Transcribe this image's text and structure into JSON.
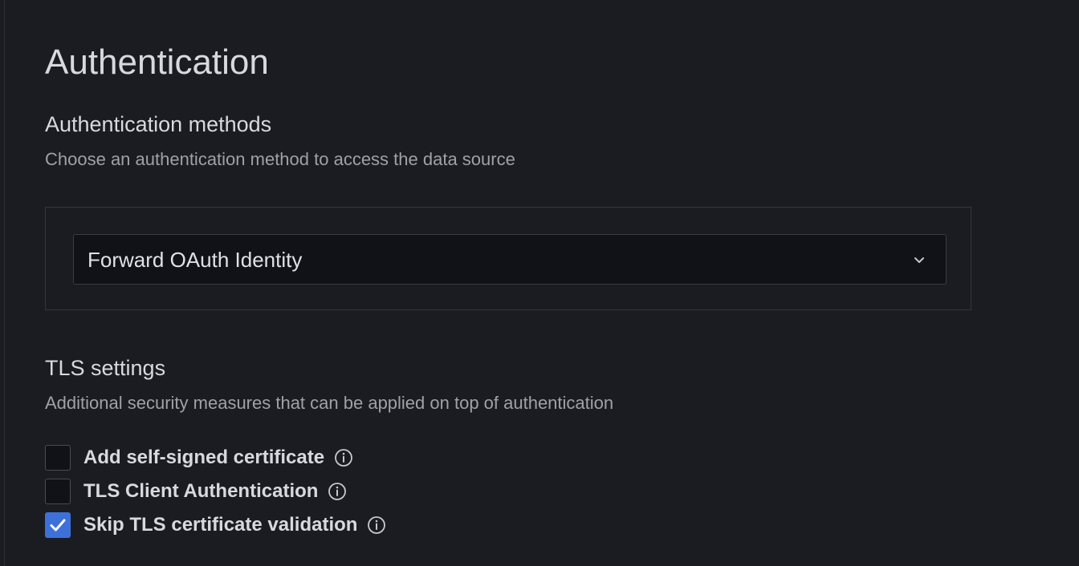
{
  "page": {
    "title": "Authentication"
  },
  "auth_methods": {
    "title": "Authentication methods",
    "description": "Choose an authentication method to access the data source",
    "select": {
      "value": "Forward OAuth Identity",
      "icon": "chevron-down-icon"
    }
  },
  "tls": {
    "title": "TLS settings",
    "description": "Additional security measures that can be applied on top of authentication",
    "options": [
      {
        "label": "Add self-signed certificate",
        "checked": false,
        "icon": "info-icon"
      },
      {
        "label": "TLS Client Authentication",
        "checked": false,
        "icon": "info-icon"
      },
      {
        "label": "Skip TLS certificate validation",
        "checked": true,
        "icon": "info-icon"
      }
    ]
  },
  "colors": {
    "background": "#1b1c21",
    "accent": "#3d71d9",
    "text_primary": "#d8d9e0",
    "text_secondary": "#9fa1a8"
  }
}
